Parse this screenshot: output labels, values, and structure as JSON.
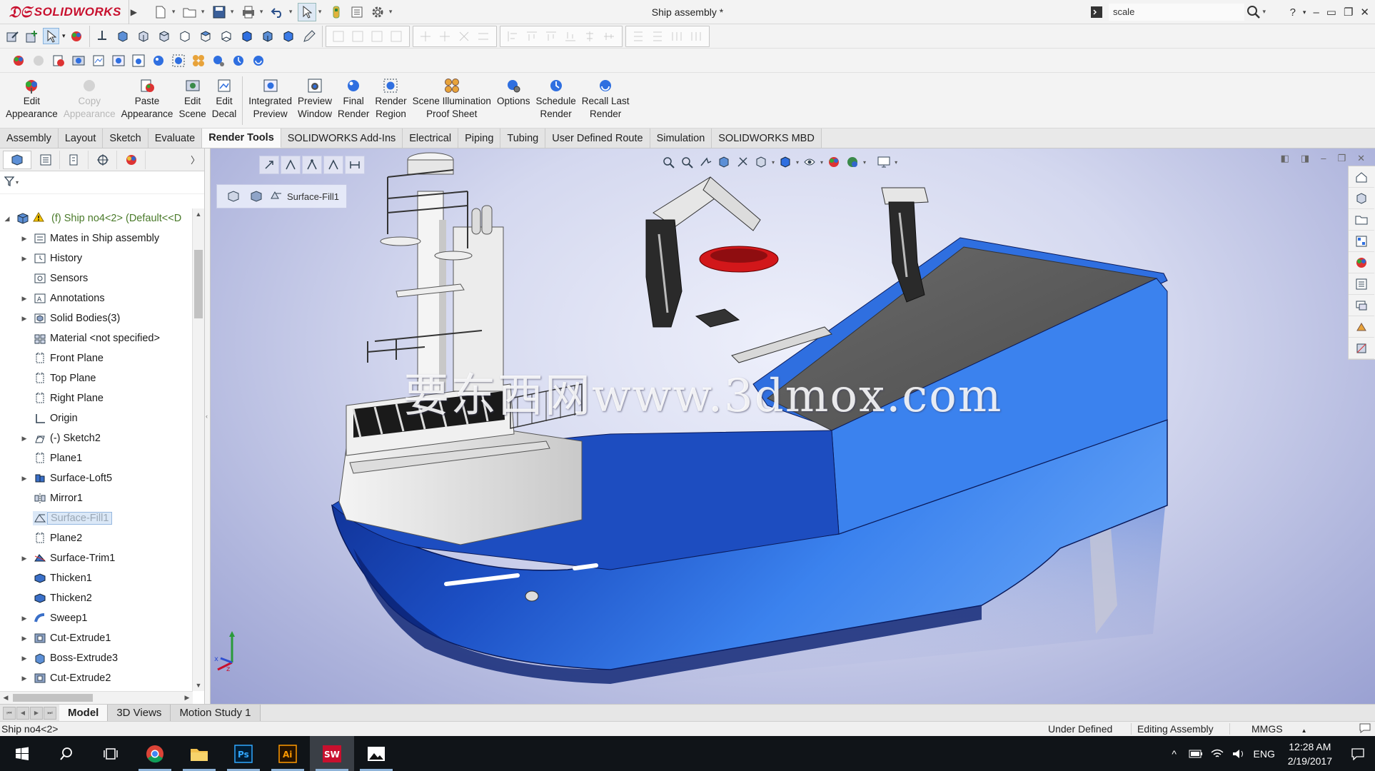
{
  "app": {
    "brand": "SOLIDWORKS",
    "window_title": "Ship assembly *"
  },
  "search": {
    "value": "scale"
  },
  "command_manager": {
    "buttons": [
      {
        "line1": "Edit",
        "line2": "Appearance",
        "icon": "edit-appearance-icon",
        "enabled": true
      },
      {
        "line1": "Copy",
        "line2": "Appearance",
        "icon": "copy-appearance-icon",
        "enabled": false
      },
      {
        "line1": "Paste",
        "line2": "Appearance",
        "icon": "paste-appearance-icon",
        "enabled": true
      },
      {
        "line1": "Edit",
        "line2": "Scene",
        "icon": "edit-scene-icon",
        "enabled": true
      },
      {
        "line1": "Edit",
        "line2": "Decal",
        "icon": "edit-decal-icon",
        "enabled": true
      },
      {
        "line1": "Integrated",
        "line2": "Preview",
        "icon": "integrated-preview-icon",
        "enabled": true
      },
      {
        "line1": "Preview",
        "line2": "Window",
        "icon": "preview-window-icon",
        "enabled": true
      },
      {
        "line1": "Final",
        "line2": "Render",
        "icon": "final-render-icon",
        "enabled": true
      },
      {
        "line1": "Render",
        "line2": "Region",
        "icon": "render-region-icon",
        "enabled": true
      },
      {
        "line1": "Scene Illumination",
        "line2": "Proof Sheet",
        "icon": "scene-illumination-icon",
        "enabled": true
      },
      {
        "line1": "Options",
        "line2": "",
        "icon": "options-icon",
        "enabled": true
      },
      {
        "line1": "Schedule",
        "line2": "Render",
        "icon": "schedule-render-icon",
        "enabled": true
      },
      {
        "line1": "Recall Last",
        "line2": "Render",
        "icon": "recall-last-render-icon",
        "enabled": true
      }
    ]
  },
  "tabs": [
    "Assembly",
    "Layout",
    "Sketch",
    "Evaluate",
    "Render Tools",
    "SOLIDWORKS Add-Ins",
    "Electrical",
    "Piping",
    "Tubing",
    "User Defined Route",
    "Simulation",
    "SOLIDWORKS MBD"
  ],
  "active_tab": "Render Tools",
  "tree": {
    "root": "(f) Ship no4<2> (Default<<D",
    "items": [
      {
        "label": "Mates in Ship assembly",
        "icon": "mates-icon",
        "expandable": true
      },
      {
        "label": "History",
        "icon": "history-icon",
        "expandable": true
      },
      {
        "label": "Sensors",
        "icon": "sensors-icon",
        "expandable": false
      },
      {
        "label": "Annotations",
        "icon": "annotations-icon",
        "expandable": true
      },
      {
        "label": "Solid Bodies(3)",
        "icon": "solid-bodies-icon",
        "expandable": true
      },
      {
        "label": "Material <not specified>",
        "icon": "material-icon",
        "expandable": false
      },
      {
        "label": "Front Plane",
        "icon": "plane-icon",
        "expandable": false
      },
      {
        "label": "Top Plane",
        "icon": "plane-icon",
        "expandable": false
      },
      {
        "label": "Right Plane",
        "icon": "plane-icon",
        "expandable": false
      },
      {
        "label": "Origin",
        "icon": "origin-icon",
        "expandable": false
      },
      {
        "label": "(-) Sketch2",
        "icon": "sketch-icon",
        "expandable": true
      },
      {
        "label": "Plane1",
        "icon": "plane-icon",
        "expandable": false
      },
      {
        "label": "Surface-Loft5",
        "icon": "surface-loft-icon",
        "expandable": true
      },
      {
        "label": "Mirror1",
        "icon": "mirror-icon",
        "expandable": false
      },
      {
        "label": "Surface-Fill1",
        "icon": "surface-fill-icon",
        "expandable": false,
        "selected": true
      },
      {
        "label": "Plane2",
        "icon": "plane-icon",
        "expandable": false
      },
      {
        "label": "Surface-Trim1",
        "icon": "surface-trim-icon",
        "expandable": true
      },
      {
        "label": "Thicken1",
        "icon": "thicken-icon",
        "expandable": false
      },
      {
        "label": "Thicken2",
        "icon": "thicken-icon",
        "expandable": false
      },
      {
        "label": "Sweep1",
        "icon": "sweep-icon",
        "expandable": true
      },
      {
        "label": "Cut-Extrude1",
        "icon": "cut-extrude-icon",
        "expandable": true
      },
      {
        "label": "Boss-Extrude3",
        "icon": "boss-extrude-icon",
        "expandable": true
      },
      {
        "label": "Cut-Extrude2",
        "icon": "cut-extrude-icon",
        "expandable": true
      }
    ]
  },
  "viewport": {
    "breadcrumb_label": "Surface-Fill1",
    "watermark": "要东西网www.3dmox.com",
    "hull_color": "#2f6fe0",
    "deck_color": "#5a5a5a"
  },
  "bottom_tabs": [
    "Model",
    "3D Views",
    "Motion Study 1"
  ],
  "active_bottom_tab": "Model",
  "status": {
    "left": "Ship no4<2>",
    "state": "Under Defined",
    "mode": "Editing Assembly",
    "units": "MMGS"
  },
  "taskbar": {
    "lang": "ENG",
    "time": "12:28 AM",
    "date": "2/19/2017",
    "apps": [
      "start-icon",
      "search-icon",
      "task-view-icon",
      "chrome-icon",
      "file-explorer-icon",
      "photoshop-icon",
      "illustrator-icon",
      "solidworks-icon",
      "photos-icon"
    ]
  },
  "colors": {
    "brand_red": "#c8102e",
    "selection_blue": "#dbe8f7"
  }
}
